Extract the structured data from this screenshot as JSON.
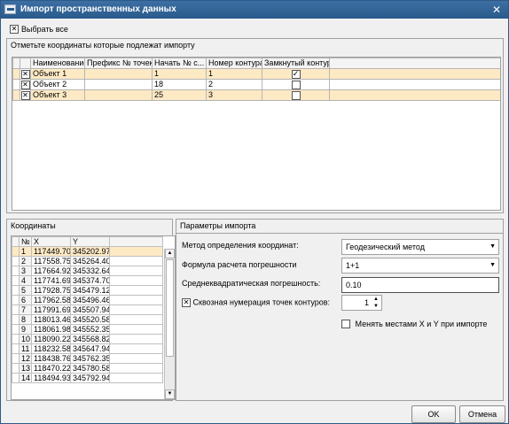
{
  "window": {
    "title": "Импорт пространственных данных",
    "close_glyph": "✕"
  },
  "select_all": {
    "label": "Выбрать все",
    "checked": true
  },
  "objects_group": {
    "title": "Отметьте координаты которые подлежат импорту",
    "columns": [
      "Наименование",
      "Префикс № точек",
      "Начать № с...",
      "Номер контура",
      "Замкнутый контур"
    ],
    "rows": [
      {
        "checked": true,
        "name": "Объект 1",
        "prefix": "",
        "start": "1",
        "contour": "1",
        "closed": true
      },
      {
        "checked": true,
        "name": "Объект 2",
        "prefix": "",
        "start": "18",
        "contour": "2",
        "closed": false
      },
      {
        "checked": true,
        "name": "Объект 3",
        "prefix": "",
        "start": "25",
        "contour": "3",
        "closed": false
      }
    ]
  },
  "coords_group": {
    "title": "Координаты",
    "columns": [
      "№",
      "X",
      "Y"
    ],
    "rows": [
      [
        "1",
        "117449.70",
        "345202.97"
      ],
      [
        "2",
        "117558.75",
        "345264.40"
      ],
      [
        "3",
        "117664.92",
        "345332.64"
      ],
      [
        "4",
        "117741.69",
        "345374.70"
      ],
      [
        "5",
        "117928.75",
        "345479.12"
      ],
      [
        "6",
        "117962.58",
        "345496.46"
      ],
      [
        "7",
        "117991.69",
        "345507.94"
      ],
      [
        "8",
        "118013.46",
        "345520.58"
      ],
      [
        "9",
        "118061.98",
        "345552.35"
      ],
      [
        "10",
        "118090.22",
        "345568.82"
      ],
      [
        "11",
        "118232.58",
        "345647.94"
      ],
      [
        "12",
        "118438.76",
        "345762.35"
      ],
      [
        "13",
        "118470.22",
        "345780.58"
      ],
      [
        "14",
        "118494.93",
        "345792.94"
      ]
    ]
  },
  "params_group": {
    "title": "Параметры импорта",
    "method_label": "Метод определения координат:",
    "method_value": "Геодезический метод",
    "formula_label": "Формула расчета погрешности",
    "formula_value": "1+1",
    "rms_label": "Среднеквадратическая погрешность:",
    "rms_value": "0.10",
    "through_numbering_label": "Сквозная нумерация точек контуров:",
    "through_numbering_checked": true,
    "through_numbering_value": "1",
    "swap_xy_label": "Менять местами X и Y при импорте",
    "swap_xy_checked": false
  },
  "buttons": {
    "ok": "OK",
    "cancel": "Отмена"
  }
}
